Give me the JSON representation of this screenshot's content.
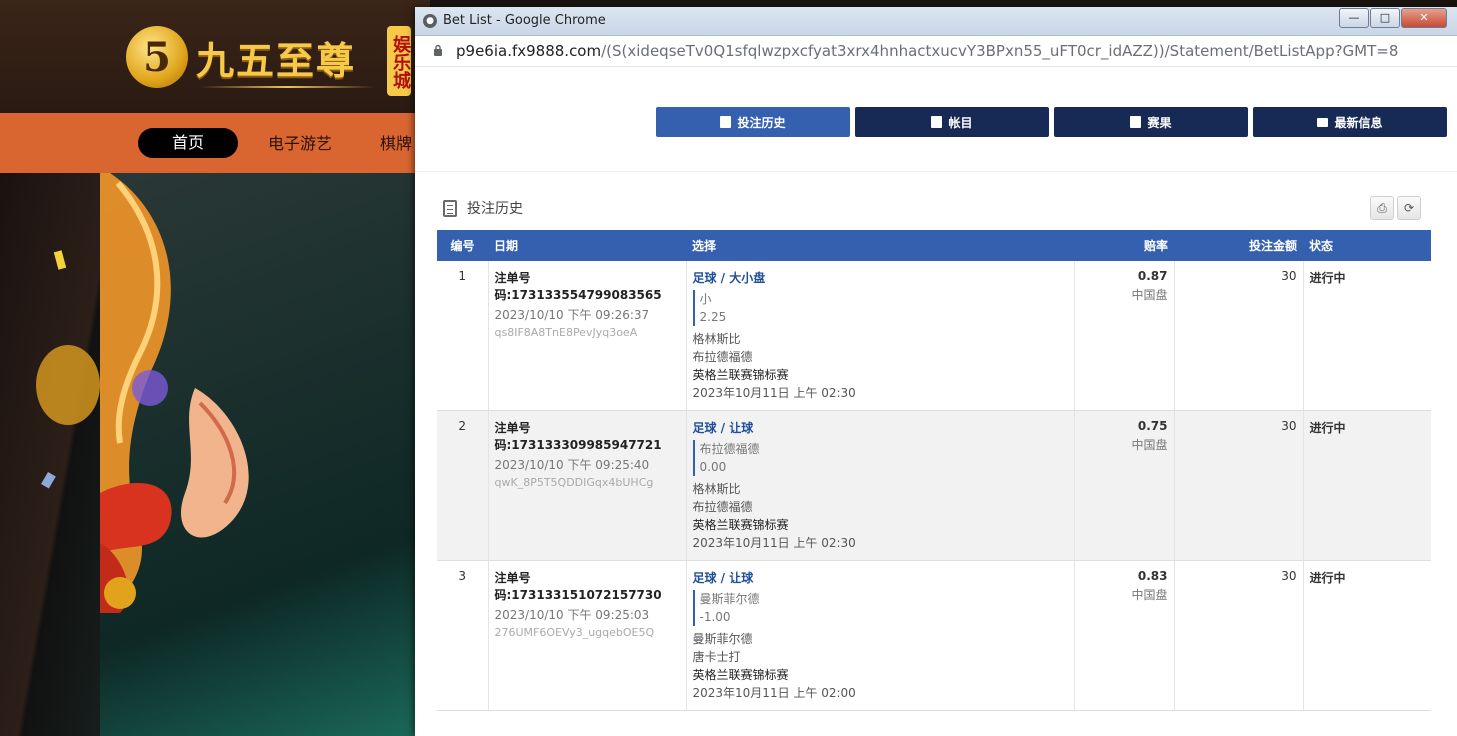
{
  "site": {
    "logo_badge": "娱乐城",
    "logo_mark": "5",
    "logo_text": "九五至尊",
    "nav": [
      "首页",
      "电子游艺",
      "棋牌"
    ]
  },
  "window": {
    "title": "Bet List - Google Chrome",
    "url_host": "p9e6ia.fx9888.com",
    "url_path": "/(S(xideqseTv0Q1sfqlwzpxcfyat3xrx4hnhactxucvY3BPxn55_uFT0cr_idAZZ))/Statement/BetListApp?GMT=8",
    "controls": {
      "minimize": "—",
      "maximize": "□",
      "close": "✕"
    }
  },
  "tabs": [
    {
      "label": "投注历史",
      "icon": "clipboard-icon",
      "active": true
    },
    {
      "label": "帐目",
      "icon": "ledger-icon",
      "active": false
    },
    {
      "label": "赛果",
      "icon": "results-icon",
      "active": false
    },
    {
      "label": "最新信息",
      "icon": "envelope-icon",
      "active": false
    }
  ],
  "section_title": "投注历史",
  "tools": {
    "print": "⎙",
    "refresh": "⟳"
  },
  "columns": [
    "编号",
    "日期",
    "选择",
    "赔率",
    "投注金额",
    "状态"
  ],
  "bets": [
    {
      "no": "1",
      "ref": "注单号码:173133554799083565",
      "date": "2023/10/10 下午 09:26:37",
      "code": "qs8IF8A8TnE8PevJyq3oeA",
      "market": "足球 / 大小盘",
      "pick": "小",
      "line": "2.25",
      "home": "格林斯比",
      "away": "布拉德福德",
      "league": "英格兰联赛锦标赛",
      "kickoff": "2023年10月11日 上午 02:30",
      "odds": "0.87",
      "odds_type": "中国盘",
      "stake": "30",
      "status": "进行中"
    },
    {
      "no": "2",
      "ref": "注单号码:173133309985947721",
      "date": "2023/10/10 下午 09:25:40",
      "code": "qwK_8P5T5QDDIGqx4bUHCg",
      "market": "足球 / 让球",
      "pick": "布拉德福德",
      "line": "0.00",
      "home": "格林斯比",
      "away": "布拉德福德",
      "league": "英格兰联赛锦标赛",
      "kickoff": "2023年10月11日 上午 02:30",
      "odds": "0.75",
      "odds_type": "中国盘",
      "stake": "30",
      "status": "进行中"
    },
    {
      "no": "3",
      "ref": "注单号码:173133151072157730",
      "date": "2023/10/10 下午 09:25:03",
      "code": "276UMF6OEVy3_ugqebOE5Q",
      "market": "足球 / 让球",
      "pick": "曼斯菲尔德",
      "line": "-1.00",
      "home": "曼斯菲尔德",
      "away": "唐卡士打",
      "league": "英格兰联赛锦标赛",
      "kickoff": "2023年10月11日 上午 02:00",
      "odds": "0.83",
      "odds_type": "中国盘",
      "stake": "30",
      "status": "进行中"
    }
  ],
  "colors": {
    "accent": "#3560b0",
    "tab_dark": "#172a56",
    "nav_orange": "#d96530"
  }
}
